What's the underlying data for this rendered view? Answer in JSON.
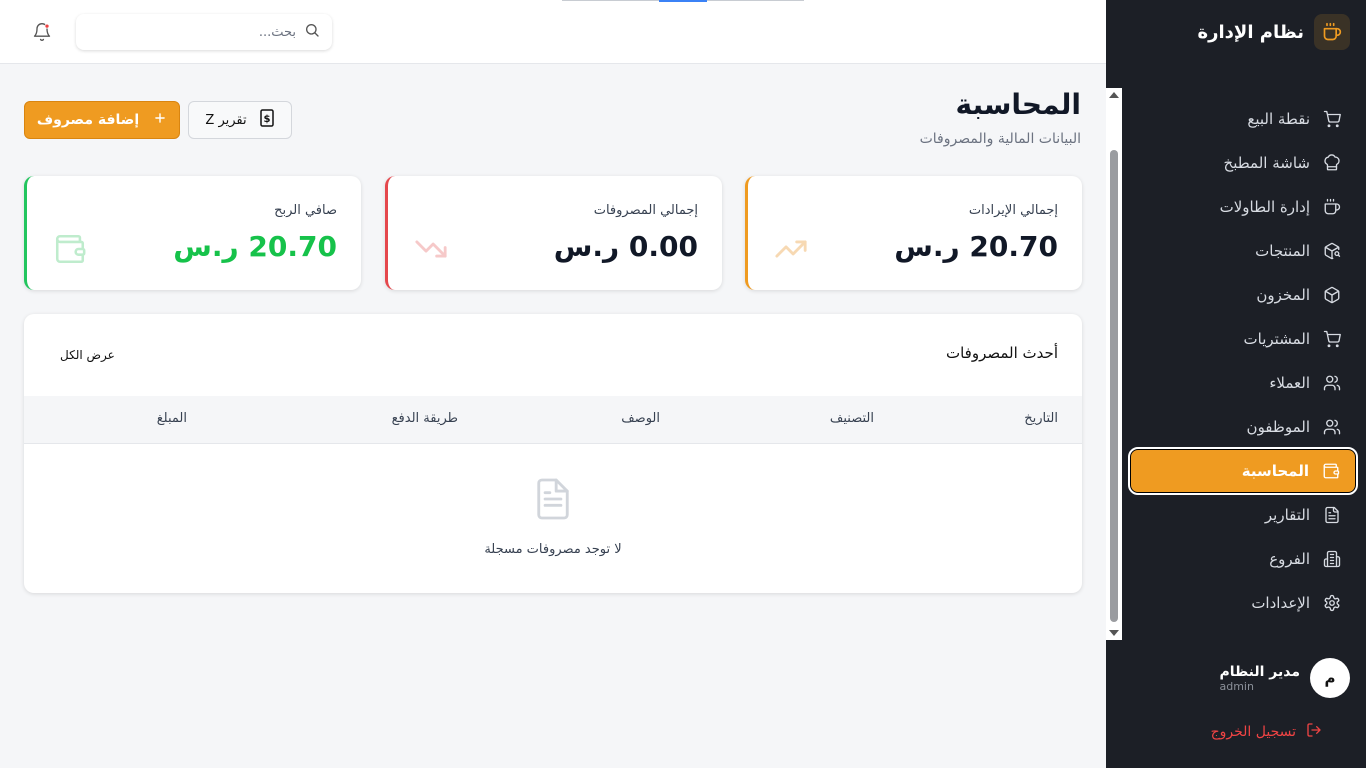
{
  "app": {
    "title": "نظام الإدارة"
  },
  "sidebar": {
    "items": [
      {
        "label": "نقطة البيع",
        "icon": "cart-icon"
      },
      {
        "label": "شاشة المطبخ",
        "icon": "chef-hat-icon"
      },
      {
        "label": "إدارة الطاولات",
        "icon": "cup-icon"
      },
      {
        "label": "المنتجات",
        "icon": "package-search-icon"
      },
      {
        "label": "المخزون",
        "icon": "box-icon"
      },
      {
        "label": "المشتريات",
        "icon": "cart-icon"
      },
      {
        "label": "العملاء",
        "icon": "users-icon"
      },
      {
        "label": "الموظفون",
        "icon": "users-icon"
      },
      {
        "label": "المحاسبة",
        "icon": "wallet-icon",
        "active": true
      },
      {
        "label": "التقارير",
        "icon": "document-icon"
      },
      {
        "label": "الفروع",
        "icon": "building-icon"
      },
      {
        "label": "الإعدادات",
        "icon": "gear-icon"
      }
    ],
    "user": {
      "initial": "م",
      "name": "مدير النظام",
      "role": "admin"
    },
    "logout_label": "تسجيل الخروج"
  },
  "topbar": {
    "search_placeholder": "بحث..."
  },
  "header": {
    "title": "المحاسبة",
    "subtitle": "البيانات المالية والمصروفات",
    "add_expense_label": "إضافة مصروف",
    "z_report_label": "تقرير Z"
  },
  "stats": {
    "revenue": {
      "label": "إجمالي الإيرادات",
      "value": "20.70 ر.س",
      "color": "#ef9b21"
    },
    "expenses": {
      "label": "إجمالي المصروفات",
      "value": "0.00 ر.س",
      "color": "#e5484d"
    },
    "profit": {
      "label": "صافي الربح",
      "value": "20.70 ر.س",
      "color": "#22c55e"
    }
  },
  "expenses_table": {
    "title": "أحدث المصروفات",
    "view_all": "عرض الكل",
    "columns": [
      "التاريخ",
      "التصنيف",
      "الوصف",
      "طريقة الدفع",
      "المبلغ"
    ],
    "rows": [],
    "empty_text": "لا توجد مصروفات مسجلة"
  },
  "colors": {
    "accent": "#ef9b21",
    "sidebar_bg": "#1c1f26",
    "danger": "#ef4444"
  }
}
